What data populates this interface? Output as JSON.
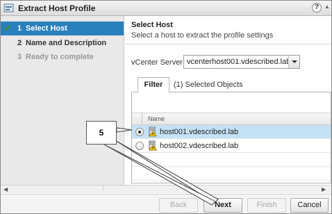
{
  "window": {
    "title": "Extract Host Profile",
    "help": "?"
  },
  "steps": [
    {
      "num": "1",
      "label": "Select Host",
      "state": "active",
      "check": "✔"
    },
    {
      "num": "2",
      "label": "Name and Description",
      "state": "pending"
    },
    {
      "num": "3",
      "label": "Ready to complete",
      "state": "disabled"
    }
  ],
  "content": {
    "title": "Select Host",
    "subtitle": "Select a host to extract the profile settings",
    "vcenter_label": "vCenter Server:",
    "vcenter_value": "vcenterhost001.vdescribed.lab"
  },
  "tabs": {
    "filter": "Filter",
    "selected": "(1) Selected Objects"
  },
  "grid": {
    "column_name": "Name",
    "rows": [
      {
        "name": "host001.vdescribed.lab",
        "selected": true
      },
      {
        "name": "host002.vdescribed.lab",
        "selected": false
      }
    ]
  },
  "buttons": {
    "back": "Back",
    "next": "Next",
    "finish": "Finish",
    "cancel": "Cancel"
  },
  "annotation": {
    "label": "5"
  },
  "colors": {
    "accent": "#2a7fbd",
    "row_selected": "#c4e1f6",
    "check": "#3a8a24"
  }
}
